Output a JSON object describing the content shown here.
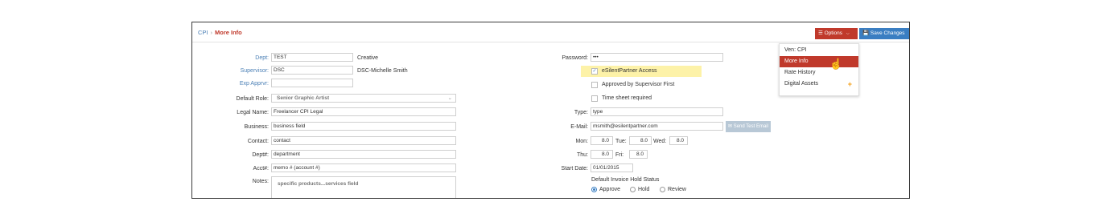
{
  "breadcrumb": {
    "parent": "CPI",
    "separator": "›",
    "current": "More Info"
  },
  "toolbar": {
    "options_label": "Options",
    "save_label": "Save Changes"
  },
  "menu": {
    "items": [
      "Ven: CPI",
      "More Info",
      "Rate History",
      "Digital Assets"
    ],
    "active": "More Info"
  },
  "left": {
    "dept": {
      "label": "Dept:",
      "value": "TEST",
      "desc": "Creative"
    },
    "supervisor": {
      "label": "Supervisor:",
      "value": "DSC",
      "desc": "DSC-Michelle Smith"
    },
    "exp_apprvr": {
      "label": "Exp Apprvr:",
      "value": ""
    },
    "default_role": {
      "label": "Default Role:",
      "value": "Senior Graphic Artist"
    },
    "legal_name": {
      "label": "Legal Name:",
      "value": "Freelancer CPI Legal"
    },
    "business": {
      "label": "Business:",
      "value": "business field"
    },
    "contact": {
      "label": "Contact:",
      "value": "contact"
    },
    "dept_num": {
      "label": "Dept#:",
      "value": "department"
    },
    "acct_num": {
      "label": "Acct#:",
      "value": "memo # (account #)"
    },
    "notes": {
      "label": "Notes:",
      "value": "specific products...services field"
    }
  },
  "right": {
    "password": {
      "label": "Password:",
      "value": "•••"
    },
    "esilent_access": {
      "label": "eSilentPartner Access",
      "checked": true
    },
    "approved_supervisor": {
      "label": "Approved by Supervisor First",
      "checked": false
    },
    "timesheet_required": {
      "label": "Time sheet required",
      "checked": false
    },
    "type": {
      "label": "Type:",
      "value": "type"
    },
    "email": {
      "label": "E-Mail:",
      "value": "msmith@esilentpartner.com",
      "send_label": "Send Test Email"
    },
    "hours": {
      "mon_label": "Mon:",
      "mon": "8.0",
      "tue_label": "Tue:",
      "tue": "8.0",
      "wed_label": "Wed:",
      "wed": "8.0",
      "thu_label": "Thu:",
      "thu": "8.0",
      "fri_label": "Fri:",
      "fri": "8.0"
    },
    "start_date": {
      "label": "Start Date:",
      "value": "01/01/2015"
    },
    "invoice_hold": {
      "label": "Default Invoice Hold Status",
      "options": [
        "Approve",
        "Hold",
        "Review"
      ],
      "selected": "Approve"
    }
  },
  "colors": {
    "accent_red": "#c0392b",
    "accent_blue": "#3a7ec2",
    "link": "#4a7fb5",
    "highlight": "#fdf2a8",
    "plus": "#f39c12"
  },
  "icons": [
    "list-icon",
    "chevron-down-icon",
    "save-icon",
    "checkmark-icon",
    "envelope-icon",
    "plus-icon",
    "hand-cursor-icon"
  ]
}
